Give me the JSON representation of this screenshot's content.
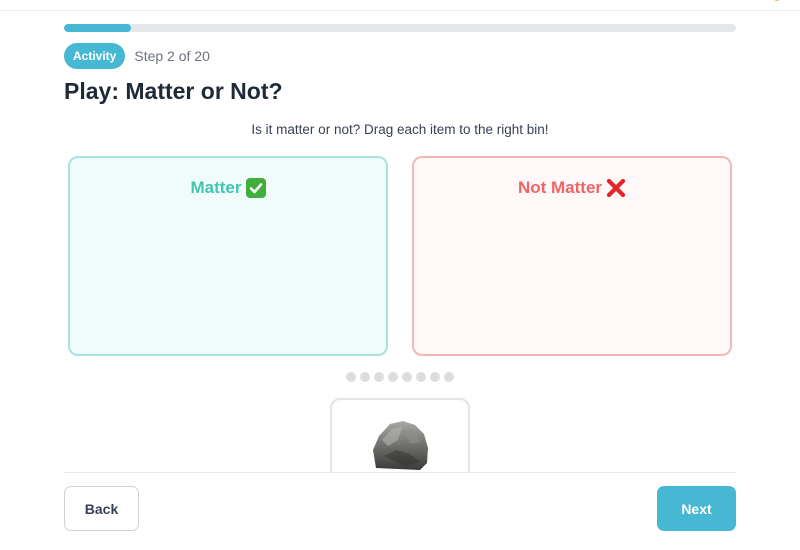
{
  "progress": {
    "current_step": 2,
    "total_steps": 20,
    "fraction": 0.1,
    "color": "#47b8d3"
  },
  "header": {
    "badge": "Activity",
    "step_label": "Step 2 of 20",
    "title": "Play: Matter or Not?"
  },
  "instruction": "Is it matter or not? Drag each item to the right bin!",
  "bins": [
    {
      "label": "Matter",
      "icon": "check-mark-icon",
      "color": "#40c6b3"
    },
    {
      "label": "Not Matter",
      "icon": "cross-mark-icon",
      "color": "#f26363"
    }
  ],
  "items": {
    "total": 8,
    "current_item_icon": "rock-icon"
  },
  "footer": {
    "back_label": "Back",
    "next_label": "Next"
  }
}
